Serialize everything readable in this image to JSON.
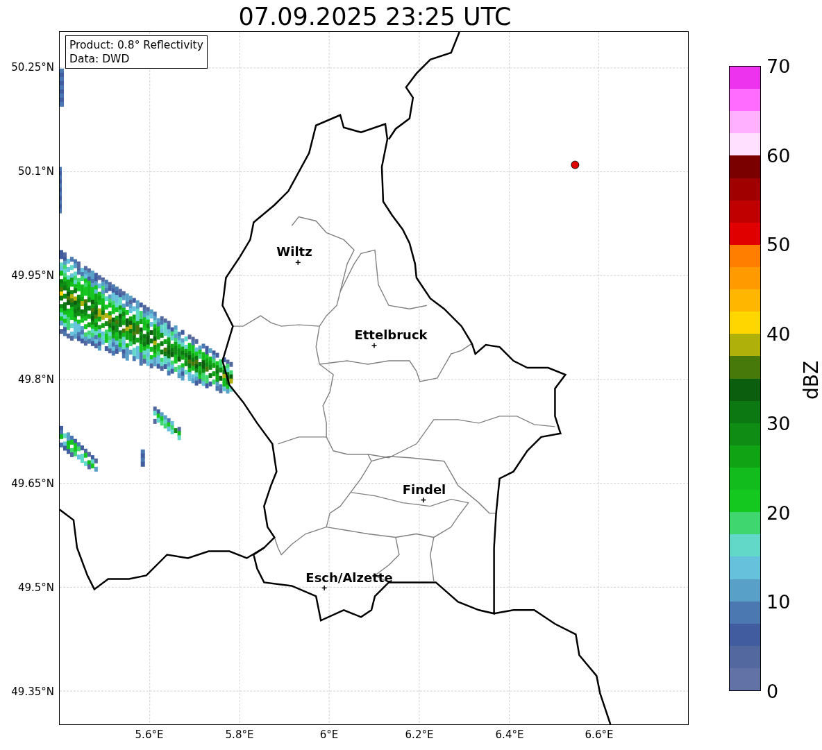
{
  "title": "07.09.2025 23:25 UTC",
  "info_box": [
    "Product: 0.8° Reflectivity",
    "Data: DWD"
  ],
  "lat_ticks": [
    "50.25°N",
    "50.1°N",
    "49.95°N",
    "49.8°N",
    "49.65°N",
    "49.5°N",
    "49.35°N"
  ],
  "lon_ticks": [
    "5.6°E",
    "5.8°E",
    "6°E",
    "6.2°E",
    "6.4°E",
    "6.6°E"
  ],
  "cities": [
    {
      "name": "Wiltz"
    },
    {
      "name": "Ettelbruck"
    },
    {
      "name": "Findel"
    },
    {
      "name": "Esch/Alzette"
    }
  ],
  "colorbar": {
    "label": "dBZ",
    "ticks": [
      "70",
      "60",
      "50",
      "40",
      "30",
      "20",
      "10",
      "0"
    ],
    "bins": [
      {
        "color": "#ee33ee"
      },
      {
        "color": "#ff6cff"
      },
      {
        "color": "#ffb0ff"
      },
      {
        "color": "#ffe0ff"
      },
      {
        "color": "#7a0000"
      },
      {
        "color": "#a00000"
      },
      {
        "color": "#c00000"
      },
      {
        "color": "#e00000"
      },
      {
        "color": "#ff7e00"
      },
      {
        "color": "#ff9a00"
      },
      {
        "color": "#ffb600"
      },
      {
        "color": "#ffd600"
      },
      {
        "color": "#b0b00a"
      },
      {
        "color": "#46780a"
      },
      {
        "color": "#0a5e0e"
      },
      {
        "color": "#0c7812"
      },
      {
        "color": "#0f8c14"
      },
      {
        "color": "#10a414"
      },
      {
        "color": "#12bc1c"
      },
      {
        "color": "#14c820"
      },
      {
        "color": "#3fd66f"
      },
      {
        "color": "#62d8c8"
      },
      {
        "color": "#66c2dc"
      },
      {
        "color": "#58a0c8"
      },
      {
        "color": "#4b78b0"
      },
      {
        "color": "#415da0"
      },
      {
        "color": "#5468a0"
      },
      {
        "color": "#6272a6"
      }
    ]
  }
}
